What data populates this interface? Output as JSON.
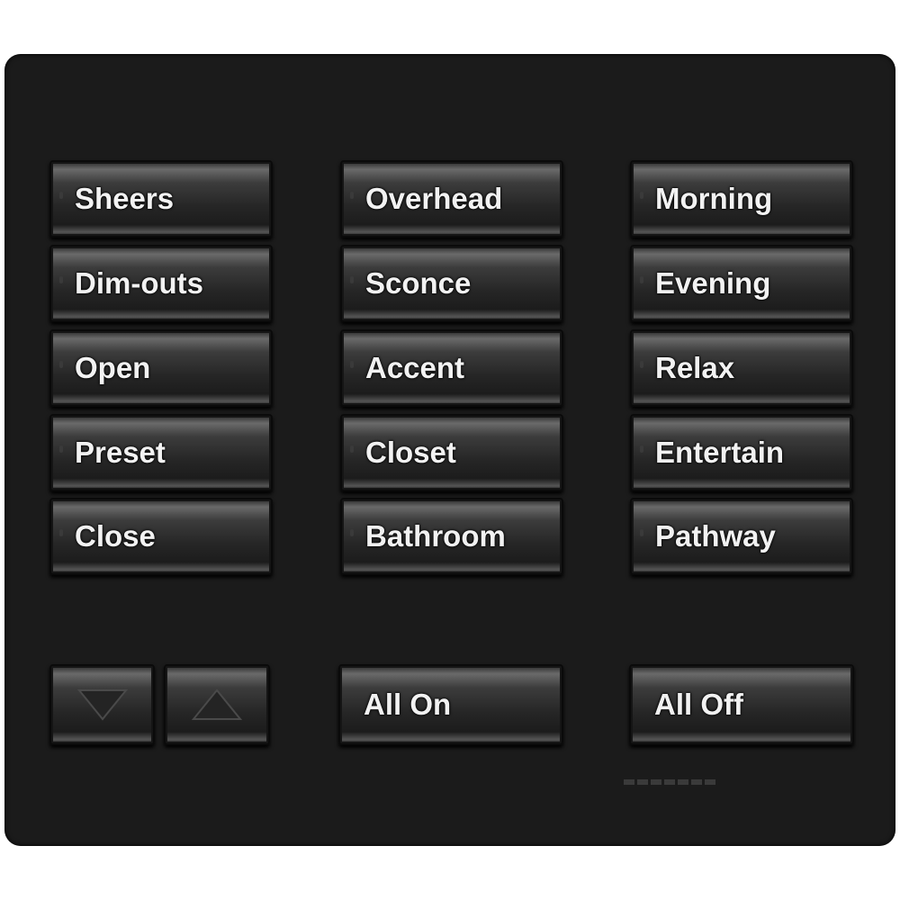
{
  "keypad": {
    "columns": [
      {
        "buttons": [
          "Sheers",
          "Dim-outs",
          "Open",
          "Preset",
          "Close"
        ]
      },
      {
        "buttons": [
          "Overhead",
          "Sconce",
          "Accent",
          "Closet",
          "Bathroom"
        ]
      },
      {
        "buttons": [
          "Morning",
          "Evening",
          "Relax",
          "Entertain",
          "Pathway"
        ]
      }
    ],
    "bottom": {
      "lower_icon": "triangle-down-icon",
      "raise_icon": "triangle-up-icon",
      "all_on": "All On",
      "all_off": "All Off"
    }
  },
  "colors": {
    "plate": "#1b1b1b",
    "label": "#f2f2f2"
  }
}
